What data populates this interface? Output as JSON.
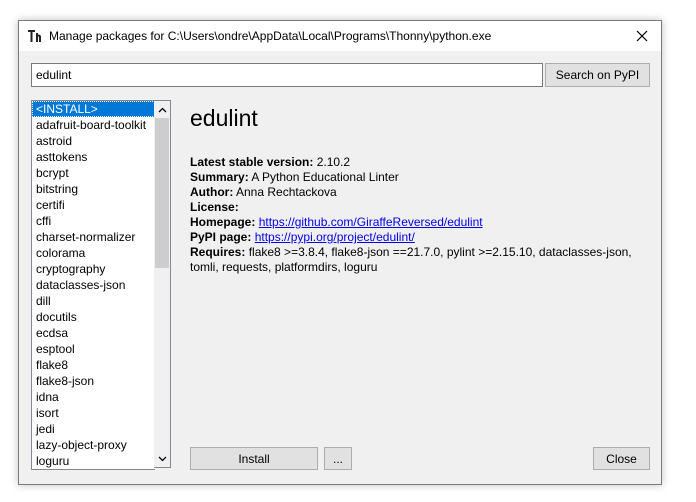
{
  "window": {
    "title": "Manage packages for C:\\Users\\ondre\\AppData\\Local\\Programs\\Thonny\\python.exe"
  },
  "search": {
    "value": "edulint",
    "button_label": "Search on PyPI"
  },
  "package_list": [
    "<INSTALL>",
    "adafruit-board-toolkit",
    "astroid",
    "asttokens",
    "bcrypt",
    "bitstring",
    "certifi",
    "cffi",
    "charset-normalizer",
    "colorama",
    "cryptography",
    "dataclasses-json",
    "dill",
    "docutils",
    "ecdsa",
    "esptool",
    "flake8",
    "flake8-json",
    "idna",
    "isort",
    "jedi",
    "lazy-object-proxy",
    "loguru"
  ],
  "selected_index": 0,
  "details": {
    "name": "edulint",
    "latest_label": "Latest stable version:",
    "latest_value": "2.10.2",
    "summary_label": "Summary:",
    "summary_value": "A Python Educational Linter",
    "author_label": "Author:",
    "author_value": "Anna Rechtackova",
    "license_label": "License:",
    "license_value": "",
    "homepage_label": "Homepage:",
    "homepage_value": "https://github.com/GiraffeReversed/edulint",
    "pypi_label": "PyPI page:",
    "pypi_value": "https://pypi.org/project/edulint/",
    "requires_label": "Requires:",
    "requires_value_1": "flake8 >=3.8.4, flake8-json ==21.7.0, pylint >=2.15.10, dataclasses-json,",
    "requires_value_2": "tomli, requests, platformdirs, loguru"
  },
  "buttons": {
    "install": "Install",
    "more": "...",
    "close": "Close"
  },
  "icons": {
    "app": "thonny-icon",
    "close": "close-icon",
    "scroll_up": "chevron-up-icon",
    "scroll_down": "chevron-down-icon"
  },
  "colors": {
    "selection": "#0078d7",
    "link": "#0000ee",
    "dialog_bg": "#f0f0f0"
  }
}
